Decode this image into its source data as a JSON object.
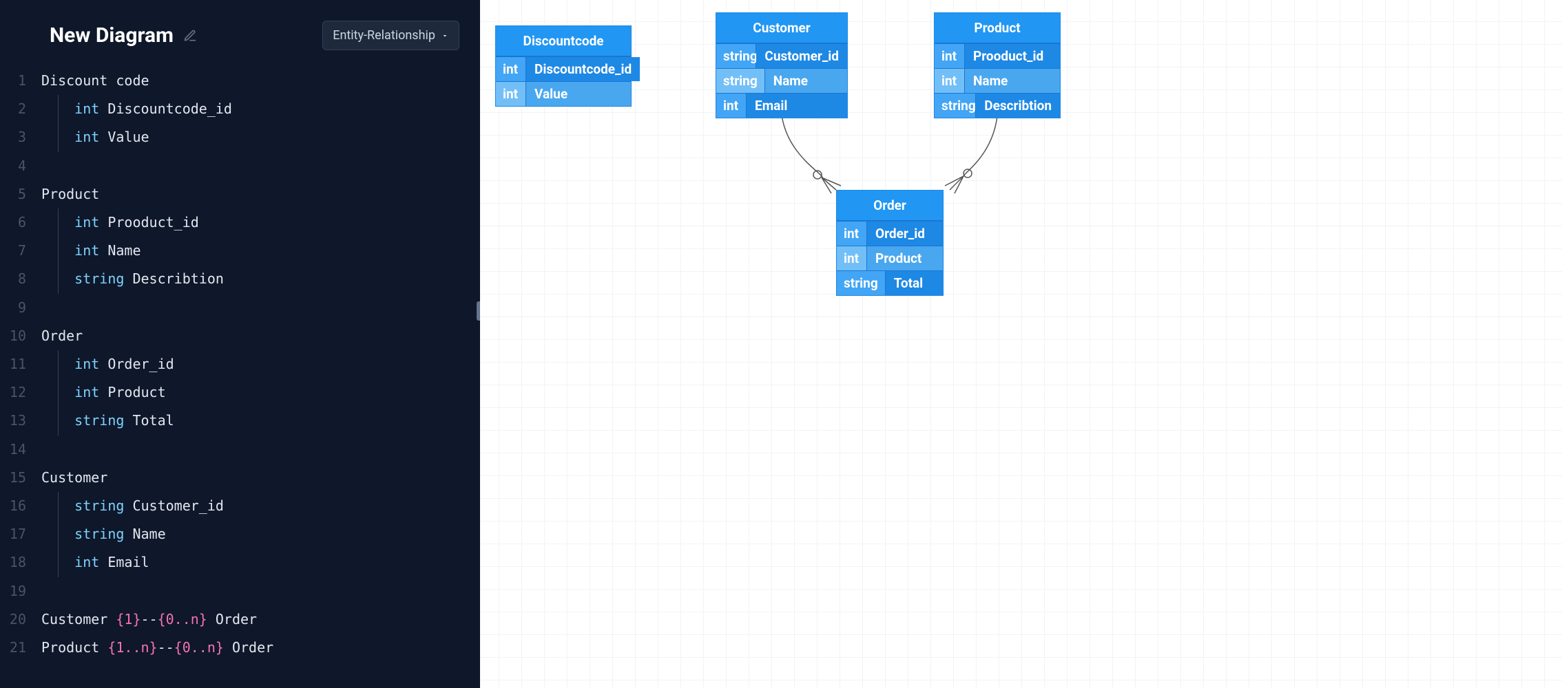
{
  "header": {
    "title": "New Diagram",
    "diagram_type_label": "Entity-Relationship"
  },
  "code": [
    {
      "n": 1,
      "indent": 0,
      "tokens": [
        [
          "ident",
          "Discount code"
        ]
      ]
    },
    {
      "n": 2,
      "indent": 1,
      "tokens": [
        [
          "type",
          "int"
        ],
        [
          "space",
          " "
        ],
        [
          "ident",
          "Discountcode_id"
        ]
      ]
    },
    {
      "n": 3,
      "indent": 1,
      "tokens": [
        [
          "type",
          "int"
        ],
        [
          "space",
          " "
        ],
        [
          "ident",
          "Value"
        ]
      ]
    },
    {
      "n": 4,
      "indent": 0,
      "tokens": []
    },
    {
      "n": 5,
      "indent": 0,
      "tokens": [
        [
          "ident",
          "Product"
        ]
      ]
    },
    {
      "n": 6,
      "indent": 1,
      "tokens": [
        [
          "type",
          "int"
        ],
        [
          "space",
          " "
        ],
        [
          "ident",
          "Prooduct_id"
        ]
      ]
    },
    {
      "n": 7,
      "indent": 1,
      "tokens": [
        [
          "type",
          "int"
        ],
        [
          "space",
          " "
        ],
        [
          "ident",
          "Name"
        ]
      ]
    },
    {
      "n": 8,
      "indent": 1,
      "tokens": [
        [
          "type",
          "string"
        ],
        [
          "space",
          " "
        ],
        [
          "ident",
          "Describtion"
        ]
      ]
    },
    {
      "n": 9,
      "indent": 0,
      "tokens": []
    },
    {
      "n": 10,
      "indent": 0,
      "tokens": [
        [
          "ident",
          "Order"
        ]
      ]
    },
    {
      "n": 11,
      "indent": 1,
      "tokens": [
        [
          "type",
          "int"
        ],
        [
          "space",
          " "
        ],
        [
          "ident",
          "Order_id"
        ]
      ]
    },
    {
      "n": 12,
      "indent": 1,
      "tokens": [
        [
          "type",
          "int"
        ],
        [
          "space",
          " "
        ],
        [
          "ident",
          "Product"
        ]
      ]
    },
    {
      "n": 13,
      "indent": 1,
      "tokens": [
        [
          "type",
          "string"
        ],
        [
          "space",
          " "
        ],
        [
          "ident",
          "Total"
        ]
      ]
    },
    {
      "n": 14,
      "indent": 0,
      "tokens": []
    },
    {
      "n": 15,
      "indent": 0,
      "tokens": [
        [
          "ident",
          "Customer"
        ]
      ]
    },
    {
      "n": 16,
      "indent": 1,
      "tokens": [
        [
          "type",
          "string"
        ],
        [
          "space",
          " "
        ],
        [
          "ident",
          "Customer_id"
        ]
      ]
    },
    {
      "n": 17,
      "indent": 1,
      "tokens": [
        [
          "type",
          "string"
        ],
        [
          "space",
          " "
        ],
        [
          "ident",
          "Name"
        ]
      ]
    },
    {
      "n": 18,
      "indent": 1,
      "tokens": [
        [
          "type",
          "int"
        ],
        [
          "space",
          " "
        ],
        [
          "ident",
          "Email"
        ]
      ]
    },
    {
      "n": 19,
      "indent": 0,
      "tokens": []
    },
    {
      "n": 20,
      "indent": 0,
      "tokens": [
        [
          "ident",
          "Customer "
        ],
        [
          "rel",
          "{1}"
        ],
        [
          "ident",
          "--"
        ],
        [
          "rel",
          "{0..n}"
        ],
        [
          "ident",
          " Order"
        ]
      ]
    },
    {
      "n": 21,
      "indent": 0,
      "tokens": [
        [
          "ident",
          "Product "
        ],
        [
          "rel",
          "{1..n}"
        ],
        [
          "ident",
          "--"
        ],
        [
          "rel",
          "{0..n}"
        ],
        [
          "ident",
          " Order"
        ]
      ]
    }
  ],
  "entities": {
    "discountcode": {
      "title": "Discountcode",
      "rows": [
        {
          "type": "int",
          "name": "Discountcode_id"
        },
        {
          "type": "int",
          "name": "Value"
        }
      ]
    },
    "customer": {
      "title": "Customer",
      "rows": [
        {
          "type": "string",
          "name": "Customer_id"
        },
        {
          "type": "string",
          "name": "Name"
        },
        {
          "type": "int",
          "name": "Email"
        }
      ]
    },
    "product": {
      "title": "Product",
      "rows": [
        {
          "type": "int",
          "name": "Prooduct_id"
        },
        {
          "type": "int",
          "name": "Name"
        },
        {
          "type": "string",
          "name": "Describtion"
        }
      ]
    },
    "order": {
      "title": "Order",
      "rows": [
        {
          "type": "int",
          "name": "Order_id"
        },
        {
          "type": "int",
          "name": "Product"
        },
        {
          "type": "string",
          "name": "Total"
        }
      ]
    }
  }
}
